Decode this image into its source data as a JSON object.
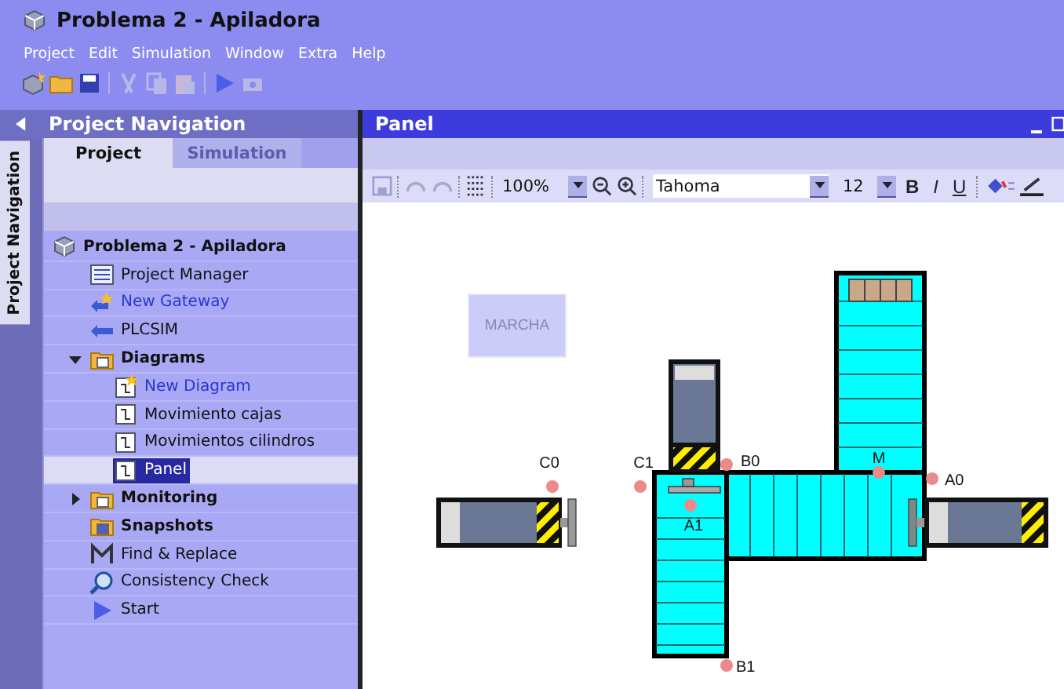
{
  "window": {
    "title": "Problema 2 - Apiladora"
  },
  "menu": [
    "Project",
    "Edit",
    "Simulation",
    "Window",
    "Extra",
    "Help"
  ],
  "navigation": {
    "title": "Project Navigation",
    "side_tab": "Project Navigation",
    "tabs": [
      {
        "label": "Project",
        "selected": true
      },
      {
        "label": "Simulation",
        "selected": false
      }
    ],
    "tree": [
      {
        "label": "Problema 2 - Apiladora",
        "kind": "root",
        "selected": false,
        "children": [
          {
            "label": "Project Manager",
            "kind": "manager",
            "selected": false
          },
          {
            "label": "New Gateway",
            "kind": "gateway",
            "selected": false
          },
          {
            "label": "PLCSIM",
            "kind": "plcsim",
            "selected": false
          },
          {
            "label": "Diagrams",
            "kind": "folder",
            "selected": false,
            "expanded": true,
            "children": [
              {
                "label": "New Diagram",
                "kind": "new-diagram",
                "selected": false
              },
              {
                "label": "Movimiento cajas",
                "kind": "diagram",
                "selected": false
              },
              {
                "label": "Movimientos cilindros",
                "kind": "diagram",
                "selected": false
              },
              {
                "label": "Panel",
                "kind": "diagram",
                "selected": true
              }
            ]
          },
          {
            "label": "Monitoring",
            "kind": "folder",
            "selected": false,
            "expanded": false
          },
          {
            "label": "Snapshots",
            "kind": "snapshots",
            "selected": false
          },
          {
            "label": "Find & Replace",
            "kind": "find",
            "selected": false
          },
          {
            "label": "Consistency Check",
            "kind": "check",
            "selected": false
          },
          {
            "label": "Start",
            "kind": "start",
            "selected": false
          }
        ]
      }
    ]
  },
  "panel": {
    "title": "Panel",
    "toolbar": {
      "zoom": "100%",
      "font": "Tahoma",
      "size": "12",
      "format": [
        "B",
        "I",
        "U"
      ]
    },
    "canvas": {
      "button": "MARCHA",
      "sensors": [
        {
          "label": "C0"
        },
        {
          "label": "C1"
        },
        {
          "label": "B0"
        },
        {
          "label": "M"
        },
        {
          "label": "A0"
        },
        {
          "label": "A1"
        },
        {
          "label": "B1"
        }
      ]
    }
  }
}
